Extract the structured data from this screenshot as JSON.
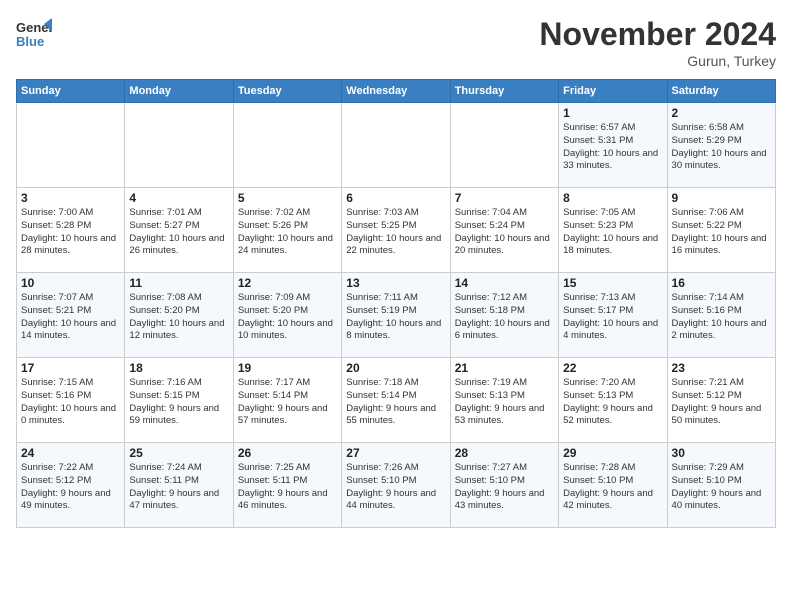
{
  "logo": {
    "line1": "General",
    "line2": "Blue"
  },
  "title": "November 2024",
  "subtitle": "Gurun, Turkey",
  "days_of_week": [
    "Sunday",
    "Monday",
    "Tuesday",
    "Wednesday",
    "Thursday",
    "Friday",
    "Saturday"
  ],
  "weeks": [
    [
      {
        "day": "",
        "info": ""
      },
      {
        "day": "",
        "info": ""
      },
      {
        "day": "",
        "info": ""
      },
      {
        "day": "",
        "info": ""
      },
      {
        "day": "",
        "info": ""
      },
      {
        "day": "1",
        "info": "Sunrise: 6:57 AM\nSunset: 5:31 PM\nDaylight: 10 hours and 33 minutes."
      },
      {
        "day": "2",
        "info": "Sunrise: 6:58 AM\nSunset: 5:29 PM\nDaylight: 10 hours and 30 minutes."
      }
    ],
    [
      {
        "day": "3",
        "info": "Sunrise: 7:00 AM\nSunset: 5:28 PM\nDaylight: 10 hours and 28 minutes."
      },
      {
        "day": "4",
        "info": "Sunrise: 7:01 AM\nSunset: 5:27 PM\nDaylight: 10 hours and 26 minutes."
      },
      {
        "day": "5",
        "info": "Sunrise: 7:02 AM\nSunset: 5:26 PM\nDaylight: 10 hours and 24 minutes."
      },
      {
        "day": "6",
        "info": "Sunrise: 7:03 AM\nSunset: 5:25 PM\nDaylight: 10 hours and 22 minutes."
      },
      {
        "day": "7",
        "info": "Sunrise: 7:04 AM\nSunset: 5:24 PM\nDaylight: 10 hours and 20 minutes."
      },
      {
        "day": "8",
        "info": "Sunrise: 7:05 AM\nSunset: 5:23 PM\nDaylight: 10 hours and 18 minutes."
      },
      {
        "day": "9",
        "info": "Sunrise: 7:06 AM\nSunset: 5:22 PM\nDaylight: 10 hours and 16 minutes."
      }
    ],
    [
      {
        "day": "10",
        "info": "Sunrise: 7:07 AM\nSunset: 5:21 PM\nDaylight: 10 hours and 14 minutes."
      },
      {
        "day": "11",
        "info": "Sunrise: 7:08 AM\nSunset: 5:20 PM\nDaylight: 10 hours and 12 minutes."
      },
      {
        "day": "12",
        "info": "Sunrise: 7:09 AM\nSunset: 5:20 PM\nDaylight: 10 hours and 10 minutes."
      },
      {
        "day": "13",
        "info": "Sunrise: 7:11 AM\nSunset: 5:19 PM\nDaylight: 10 hours and 8 minutes."
      },
      {
        "day": "14",
        "info": "Sunrise: 7:12 AM\nSunset: 5:18 PM\nDaylight: 10 hours and 6 minutes."
      },
      {
        "day": "15",
        "info": "Sunrise: 7:13 AM\nSunset: 5:17 PM\nDaylight: 10 hours and 4 minutes."
      },
      {
        "day": "16",
        "info": "Sunrise: 7:14 AM\nSunset: 5:16 PM\nDaylight: 10 hours and 2 minutes."
      }
    ],
    [
      {
        "day": "17",
        "info": "Sunrise: 7:15 AM\nSunset: 5:16 PM\nDaylight: 10 hours and 0 minutes."
      },
      {
        "day": "18",
        "info": "Sunrise: 7:16 AM\nSunset: 5:15 PM\nDaylight: 9 hours and 59 minutes."
      },
      {
        "day": "19",
        "info": "Sunrise: 7:17 AM\nSunset: 5:14 PM\nDaylight: 9 hours and 57 minutes."
      },
      {
        "day": "20",
        "info": "Sunrise: 7:18 AM\nSunset: 5:14 PM\nDaylight: 9 hours and 55 minutes."
      },
      {
        "day": "21",
        "info": "Sunrise: 7:19 AM\nSunset: 5:13 PM\nDaylight: 9 hours and 53 minutes."
      },
      {
        "day": "22",
        "info": "Sunrise: 7:20 AM\nSunset: 5:13 PM\nDaylight: 9 hours and 52 minutes."
      },
      {
        "day": "23",
        "info": "Sunrise: 7:21 AM\nSunset: 5:12 PM\nDaylight: 9 hours and 50 minutes."
      }
    ],
    [
      {
        "day": "24",
        "info": "Sunrise: 7:22 AM\nSunset: 5:12 PM\nDaylight: 9 hours and 49 minutes."
      },
      {
        "day": "25",
        "info": "Sunrise: 7:24 AM\nSunset: 5:11 PM\nDaylight: 9 hours and 47 minutes."
      },
      {
        "day": "26",
        "info": "Sunrise: 7:25 AM\nSunset: 5:11 PM\nDaylight: 9 hours and 46 minutes."
      },
      {
        "day": "27",
        "info": "Sunrise: 7:26 AM\nSunset: 5:10 PM\nDaylight: 9 hours and 44 minutes."
      },
      {
        "day": "28",
        "info": "Sunrise: 7:27 AM\nSunset: 5:10 PM\nDaylight: 9 hours and 43 minutes."
      },
      {
        "day": "29",
        "info": "Sunrise: 7:28 AM\nSunset: 5:10 PM\nDaylight: 9 hours and 42 minutes."
      },
      {
        "day": "30",
        "info": "Sunrise: 7:29 AM\nSunset: 5:10 PM\nDaylight: 9 hours and 40 minutes."
      }
    ]
  ]
}
